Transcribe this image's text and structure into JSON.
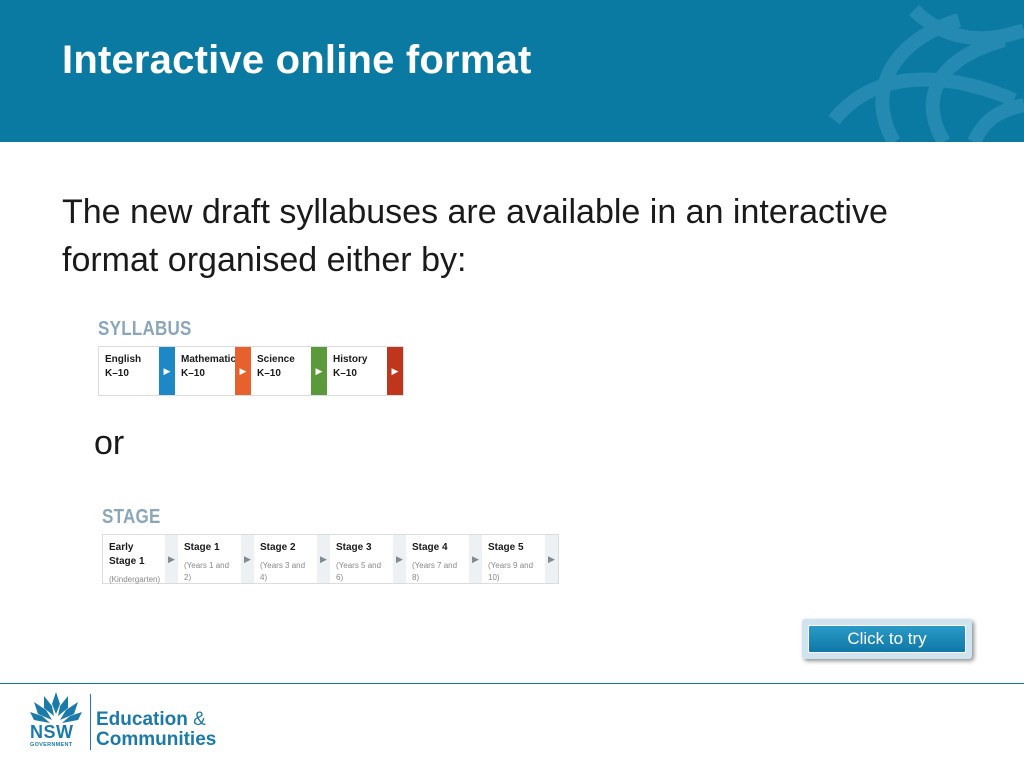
{
  "slide": {
    "title": "Interactive online format",
    "body": "The new draft syllabuses are available in an interactive format organised either by:",
    "or": "or"
  },
  "syllabus_nav": {
    "label": "SYLLABUS",
    "items": [
      {
        "name": "English",
        "sub": "K–10",
        "arrow_color": "#1e88c7"
      },
      {
        "name": "Mathematics",
        "sub": "K–10",
        "arrow_color": "#e8602c"
      },
      {
        "name": "Science",
        "sub": "K–10",
        "arrow_color": "#5a9a3a"
      },
      {
        "name": "History",
        "sub": "K–10",
        "arrow_color": "#c0361c"
      }
    ]
  },
  "stage_nav": {
    "label": "STAGE",
    "items": [
      {
        "name": "Early Stage 1",
        "sub": "(Kindergarten)"
      },
      {
        "name": "Stage 1",
        "sub": "(Years 1 and 2)"
      },
      {
        "name": "Stage 2",
        "sub": "(Years 3 and 4)"
      },
      {
        "name": "Stage 3",
        "sub": "(Years 5 and 6)"
      },
      {
        "name": "Stage 4",
        "sub": "(Years 7 and 8)"
      },
      {
        "name": "Stage 5",
        "sub": "(Years 9 and 10)"
      }
    ]
  },
  "cta": {
    "label": "Click to try"
  },
  "footer": {
    "logo_nsw": "NSW",
    "logo_gov": "GOVERNMENT",
    "logo_edu_line1": "Education",
    "logo_amp": "&",
    "logo_edu_line2": "Communities"
  },
  "colors": {
    "header": "#0a7aa3",
    "accent": "#1b7aa8"
  },
  "icons": {
    "arrow": "caret-right-icon",
    "logo": "waratah-icon"
  }
}
